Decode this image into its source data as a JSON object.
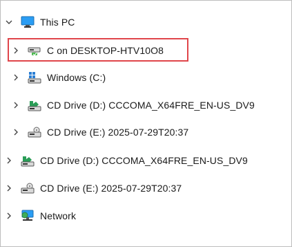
{
  "tree": {
    "this_pc": {
      "label": "This PC",
      "icon": "monitor-icon",
      "expanded": true
    },
    "items": [
      {
        "label": "C on DESKTOP-HTV10O8",
        "icon": "network-drive-icon"
      },
      {
        "label": "Windows (C:)",
        "icon": "windows-drive-icon"
      },
      {
        "label": "CD Drive (D:) CCCOMA_X64FRE_EN-US_DV9",
        "icon": "cd-drive-icon"
      },
      {
        "label": "CD Drive (E:) 2025-07-29T20:37",
        "icon": "optical-drive-icon"
      }
    ],
    "root_items": [
      {
        "label": "CD Drive (D:) CCCOMA_X64FRE_EN-US_DV9",
        "icon": "cd-drive-icon"
      },
      {
        "label": "CD Drive (E:) 2025-07-29T20:37",
        "icon": "optical-drive-icon"
      },
      {
        "label": "Network",
        "icon": "network-icon"
      }
    ]
  },
  "colors": {
    "highlight": "#e0454a",
    "accent": "#1a73c9"
  }
}
